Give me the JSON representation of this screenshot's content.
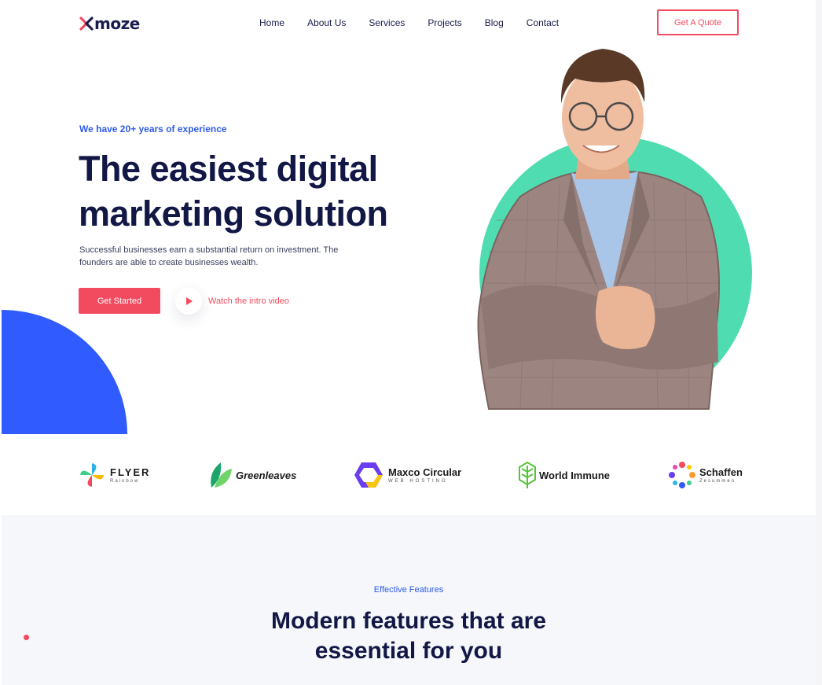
{
  "brand": {
    "name": "moze",
    "mark_color": "#f24a5e"
  },
  "nav": {
    "items": [
      "Home",
      "About Us",
      "Services",
      "Projects",
      "Blog",
      "Contact"
    ],
    "cta": "Get A Quote"
  },
  "hero": {
    "eyebrow": "We have 20+ years of experience",
    "title_line1": "The easiest digital",
    "title_line2": "marketing solution",
    "description_line1": "Successful businesses earn a substantial return on investment. The",
    "description_line2": "founders are able to create businesses wealth.",
    "primary_button": "Get Started",
    "video_link": "Watch the intro video"
  },
  "partners": [
    {
      "name": "FLYER",
      "sub": "Rainbow",
      "icon": "pinwheel-icon"
    },
    {
      "name": "Greenleaves",
      "sub": "",
      "icon": "leaf-icon"
    },
    {
      "name": "Maxco Circular",
      "sub": "WEB HOSTING",
      "icon": "hexagon-icon"
    },
    {
      "name": "World Immune",
      "sub": "",
      "icon": "tree-icon"
    },
    {
      "name": "Schaffen",
      "sub": "Zesummen",
      "icon": "people-circle-icon"
    }
  ],
  "features": {
    "eyebrow": "Effective Features",
    "title_line1": "Modern features that are",
    "title_line2": "essential for you"
  },
  "colors": {
    "accent": "#f24a5e",
    "primary_blue": "#2f5bff",
    "mint": "#4fdcb0",
    "heading": "#121745"
  }
}
